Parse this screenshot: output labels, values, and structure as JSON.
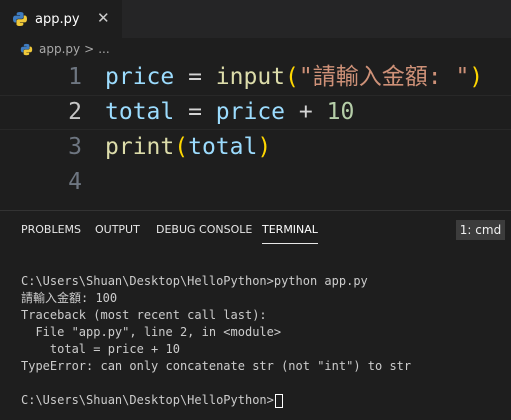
{
  "tab": {
    "filename": "app.py",
    "close_glyph": "✕",
    "file_icon": "python-icon"
  },
  "breadcrumb": {
    "file": "app.py",
    "separator": ">",
    "more": "..."
  },
  "editor": {
    "line_numbers": [
      "1",
      "2",
      "3",
      "4"
    ],
    "line1": {
      "var": "price",
      "op": " = ",
      "fn": "input",
      "open": "(",
      "str": "\"請輸入金額: \"",
      "close": ")"
    },
    "line2": {
      "var": "total",
      "op": " = ",
      "var2": "price",
      "op2": " + ",
      "num": "10"
    },
    "line3": {
      "fn": "print",
      "open": "(",
      "arg": "total",
      "close": ")"
    }
  },
  "panel": {
    "tabs": [
      "PROBLEMS",
      "OUTPUT",
      "DEBUG CONSOLE",
      "TERMINAL"
    ],
    "active_tab": "TERMINAL",
    "terminal_selector": "1: cmd"
  },
  "terminal": {
    "lines": [
      "C:\\Users\\Shuan\\Desktop\\HelloPython>python app.py",
      "請輸入金額: 100",
      "Traceback (most recent call last):",
      "  File \"app.py\", line 2, in <module>",
      "    total = price + 10",
      "TypeError: can only concatenate str (not \"int\") to str",
      "",
      "C:\\Users\\Shuan\\Desktop\\HelloPython>"
    ]
  },
  "colors": {
    "background": "#1e1e1e",
    "keyword_var": "#9cdcfe",
    "function": "#dcdcaa",
    "string": "#ce9178",
    "number": "#b5cea8"
  }
}
